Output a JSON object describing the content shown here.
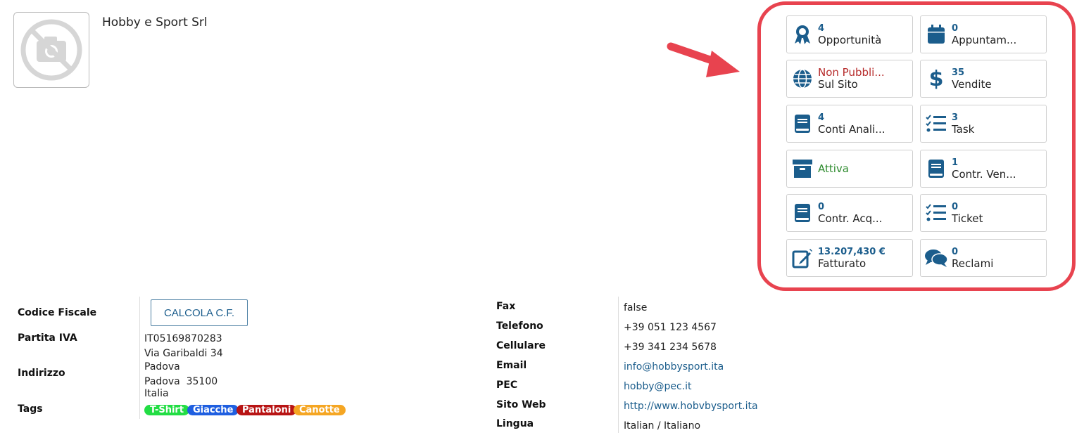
{
  "company": {
    "name": "Hobby e Sport Srl"
  },
  "tiles": [
    {
      "value": "4",
      "label": "Opportunità",
      "icon": "award-icon"
    },
    {
      "value": "0",
      "label": "Appuntam...",
      "icon": "calendar-icon"
    },
    {
      "value": "Non Pubbli...",
      "label": "Sul Sito",
      "icon": "globe-icon"
    },
    {
      "value": "35",
      "label": "Vendite",
      "icon": "dollar-icon"
    },
    {
      "value": "4",
      "label": "Conti Anali...",
      "icon": "book-icon"
    },
    {
      "value": "3",
      "label": "Task",
      "icon": "tasks-icon"
    },
    {
      "value": "",
      "label": "Attiva",
      "icon": "archive-icon"
    },
    {
      "value": "1",
      "label": "Contr. Ven...",
      "icon": "book-icon"
    },
    {
      "value": "0",
      "label": "Contr. Acq...",
      "icon": "book-icon"
    },
    {
      "value": "0",
      "label": "Ticket",
      "icon": "tasks-icon"
    },
    {
      "value": "13.207,430 €",
      "label": "Fatturato",
      "icon": "edit-icon"
    },
    {
      "value": "0",
      "label": "Reclami",
      "icon": "comments-icon"
    }
  ],
  "colors": {
    "accent": "#1b5d8c",
    "highlight": "#e8434f",
    "warning": "#b62a2a",
    "active": "#2e8b2e"
  },
  "left_info": {
    "codice_fiscale_label": "Codice Fiscale",
    "calcola_button": "CALCOLA C.F.",
    "partita_iva_label": "Partita IVA",
    "partita_iva_value": "IT05169870283",
    "indirizzo_label": "Indirizzo",
    "address_line1": "Via Garibaldi 34",
    "address_line2": "Padova",
    "address_line3": "Padova  35100",
    "address_line4": "Italia",
    "tags_label": "Tags",
    "tags": [
      {
        "label": "T-Shirt",
        "color": "#22dd44"
      },
      {
        "label": "Giacche",
        "color": "#1f5fe0"
      },
      {
        "label": "Pantaloni",
        "color": "#b81414"
      },
      {
        "label": "Canotte",
        "color": "#f5a623"
      }
    ]
  },
  "right_info": {
    "fax_label": "Fax",
    "fax_value": "false",
    "telefono_label": "Telefono",
    "telefono_value": "+39 051 123 4567",
    "cellulare_label": "Cellulare",
    "cellulare_value": "+39 341 234 5678",
    "email_label": "Email",
    "email_value": "info@hobbysport.ita",
    "pec_label": "PEC",
    "pec_value": "hobby@pec.it",
    "sito_label": "Sito Web",
    "sito_value": "http://www.hobvbysport.ita",
    "lingua_label": "Lingua",
    "lingua_value": "Italian / Italiano"
  }
}
